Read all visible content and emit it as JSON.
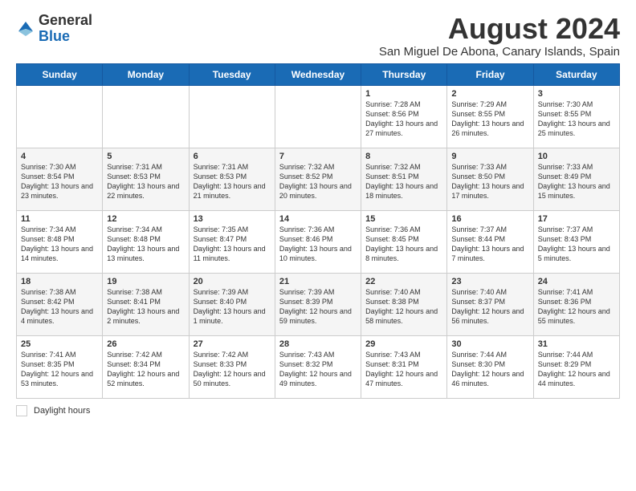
{
  "header": {
    "logo_general": "General",
    "logo_blue": "Blue",
    "month_year": "August 2024",
    "subtitle": "San Miguel De Abona, Canary Islands, Spain"
  },
  "weekdays": [
    "Sunday",
    "Monday",
    "Tuesday",
    "Wednesday",
    "Thursday",
    "Friday",
    "Saturday"
  ],
  "weeks": [
    [
      {
        "day": "",
        "info": ""
      },
      {
        "day": "",
        "info": ""
      },
      {
        "day": "",
        "info": ""
      },
      {
        "day": "",
        "info": ""
      },
      {
        "day": "1",
        "info": "Sunrise: 7:28 AM\nSunset: 8:56 PM\nDaylight: 13 hours and 27 minutes."
      },
      {
        "day": "2",
        "info": "Sunrise: 7:29 AM\nSunset: 8:55 PM\nDaylight: 13 hours and 26 minutes."
      },
      {
        "day": "3",
        "info": "Sunrise: 7:30 AM\nSunset: 8:55 PM\nDaylight: 13 hours and 25 minutes."
      }
    ],
    [
      {
        "day": "4",
        "info": "Sunrise: 7:30 AM\nSunset: 8:54 PM\nDaylight: 13 hours and 23 minutes."
      },
      {
        "day": "5",
        "info": "Sunrise: 7:31 AM\nSunset: 8:53 PM\nDaylight: 13 hours and 22 minutes."
      },
      {
        "day": "6",
        "info": "Sunrise: 7:31 AM\nSunset: 8:53 PM\nDaylight: 13 hours and 21 minutes."
      },
      {
        "day": "7",
        "info": "Sunrise: 7:32 AM\nSunset: 8:52 PM\nDaylight: 13 hours and 20 minutes."
      },
      {
        "day": "8",
        "info": "Sunrise: 7:32 AM\nSunset: 8:51 PM\nDaylight: 13 hours and 18 minutes."
      },
      {
        "day": "9",
        "info": "Sunrise: 7:33 AM\nSunset: 8:50 PM\nDaylight: 13 hours and 17 minutes."
      },
      {
        "day": "10",
        "info": "Sunrise: 7:33 AM\nSunset: 8:49 PM\nDaylight: 13 hours and 15 minutes."
      }
    ],
    [
      {
        "day": "11",
        "info": "Sunrise: 7:34 AM\nSunset: 8:48 PM\nDaylight: 13 hours and 14 minutes."
      },
      {
        "day": "12",
        "info": "Sunrise: 7:34 AM\nSunset: 8:48 PM\nDaylight: 13 hours and 13 minutes."
      },
      {
        "day": "13",
        "info": "Sunrise: 7:35 AM\nSunset: 8:47 PM\nDaylight: 13 hours and 11 minutes."
      },
      {
        "day": "14",
        "info": "Sunrise: 7:36 AM\nSunset: 8:46 PM\nDaylight: 13 hours and 10 minutes."
      },
      {
        "day": "15",
        "info": "Sunrise: 7:36 AM\nSunset: 8:45 PM\nDaylight: 13 hours and 8 minutes."
      },
      {
        "day": "16",
        "info": "Sunrise: 7:37 AM\nSunset: 8:44 PM\nDaylight: 13 hours and 7 minutes."
      },
      {
        "day": "17",
        "info": "Sunrise: 7:37 AM\nSunset: 8:43 PM\nDaylight: 13 hours and 5 minutes."
      }
    ],
    [
      {
        "day": "18",
        "info": "Sunrise: 7:38 AM\nSunset: 8:42 PM\nDaylight: 13 hours and 4 minutes."
      },
      {
        "day": "19",
        "info": "Sunrise: 7:38 AM\nSunset: 8:41 PM\nDaylight: 13 hours and 2 minutes."
      },
      {
        "day": "20",
        "info": "Sunrise: 7:39 AM\nSunset: 8:40 PM\nDaylight: 13 hours and 1 minute."
      },
      {
        "day": "21",
        "info": "Sunrise: 7:39 AM\nSunset: 8:39 PM\nDaylight: 12 hours and 59 minutes."
      },
      {
        "day": "22",
        "info": "Sunrise: 7:40 AM\nSunset: 8:38 PM\nDaylight: 12 hours and 58 minutes."
      },
      {
        "day": "23",
        "info": "Sunrise: 7:40 AM\nSunset: 8:37 PM\nDaylight: 12 hours and 56 minutes."
      },
      {
        "day": "24",
        "info": "Sunrise: 7:41 AM\nSunset: 8:36 PM\nDaylight: 12 hours and 55 minutes."
      }
    ],
    [
      {
        "day": "25",
        "info": "Sunrise: 7:41 AM\nSunset: 8:35 PM\nDaylight: 12 hours and 53 minutes."
      },
      {
        "day": "26",
        "info": "Sunrise: 7:42 AM\nSunset: 8:34 PM\nDaylight: 12 hours and 52 minutes."
      },
      {
        "day": "27",
        "info": "Sunrise: 7:42 AM\nSunset: 8:33 PM\nDaylight: 12 hours and 50 minutes."
      },
      {
        "day": "28",
        "info": "Sunrise: 7:43 AM\nSunset: 8:32 PM\nDaylight: 12 hours and 49 minutes."
      },
      {
        "day": "29",
        "info": "Sunrise: 7:43 AM\nSunset: 8:31 PM\nDaylight: 12 hours and 47 minutes."
      },
      {
        "day": "30",
        "info": "Sunrise: 7:44 AM\nSunset: 8:30 PM\nDaylight: 12 hours and 46 minutes."
      },
      {
        "day": "31",
        "info": "Sunrise: 7:44 AM\nSunset: 8:29 PM\nDaylight: 12 hours and 44 minutes."
      }
    ]
  ],
  "footer": {
    "daylight_label": "Daylight hours"
  }
}
